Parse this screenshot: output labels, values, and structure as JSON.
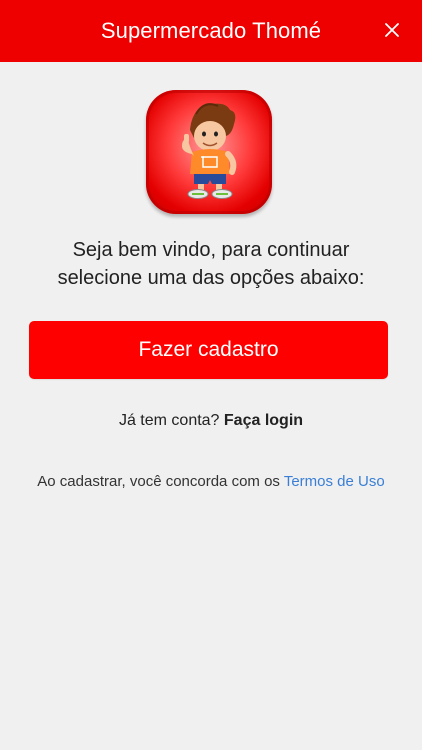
{
  "header": {
    "title": "Supermercado Thomé",
    "close_icon": "close-icon"
  },
  "logo": {
    "icon": "mascot-logo-icon",
    "colors": {
      "accent": "#ee0000"
    }
  },
  "welcome": {
    "line1": "Seja bem vindo, para continuar",
    "line2": "selecione uma das opções abaixo:"
  },
  "actions": {
    "signup_label": "Fazer cadastro",
    "login_prompt": "Já tem conta?",
    "login_link": "Faça login"
  },
  "terms": {
    "prefix": "Ao cadastrar, você concorda com os",
    "link": "Termos de Uso"
  },
  "colors": {
    "primary": "#ff0000",
    "header": "#ee0000",
    "link": "#3a7fd5",
    "background": "#f0f0f0"
  }
}
